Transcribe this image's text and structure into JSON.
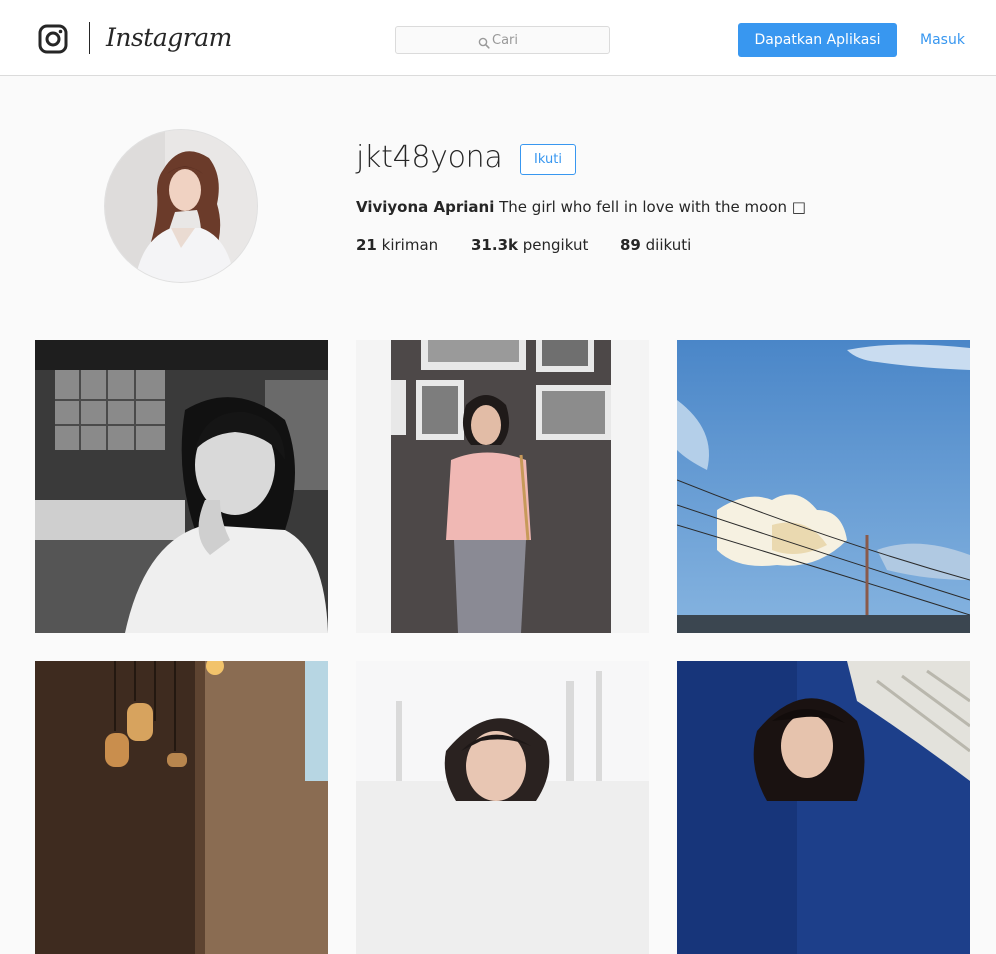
{
  "header": {
    "brand": "Instagram",
    "search": {
      "placeholder": "Cari",
      "value": ""
    },
    "get_app_label": "Dapatkan Aplikasi",
    "login_label": "Masuk"
  },
  "profile": {
    "username": "jkt48yona",
    "follow_label": "Ikuti",
    "full_name": "Viviyona Apriani",
    "bio": "The girl who fell in love with the moon □",
    "stats": {
      "posts": {
        "count": "21",
        "label": "kiriman"
      },
      "followers": {
        "count": "31.3k",
        "label": "pengikut"
      },
      "following": {
        "count": "89",
        "label": "diikuti"
      }
    }
  },
  "posts": [
    {
      "icon": "photo-bw-cafe-girl"
    },
    {
      "icon": "photo-gallery-wall-girl"
    },
    {
      "icon": "photo-blue-sky-clouds"
    },
    {
      "icon": "photo-hanging-lamps"
    },
    {
      "icon": "photo-girl-outdoor"
    },
    {
      "icon": "photo-girl-blue-window"
    }
  ],
  "colors": {
    "accent": "#3897f0",
    "text": "#262626",
    "background": "#fafafa",
    "border": "#dbdbdb"
  }
}
